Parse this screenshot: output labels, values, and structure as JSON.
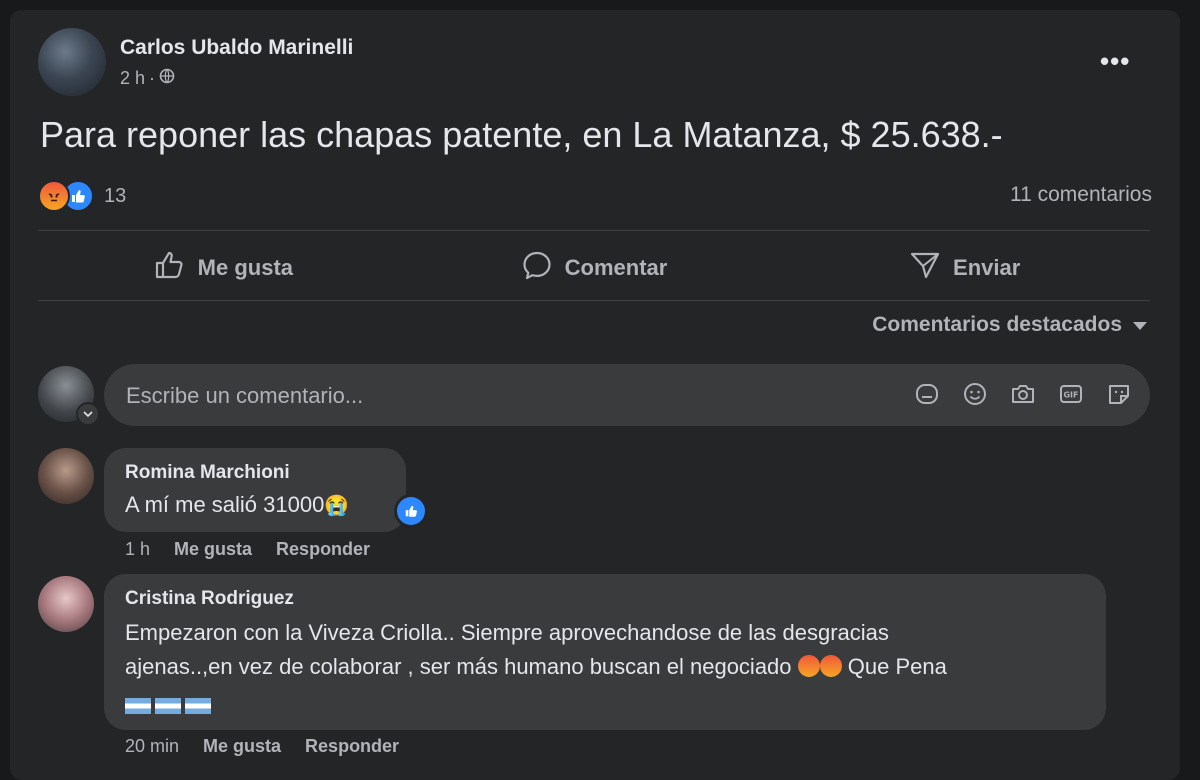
{
  "post": {
    "author": "Carlos Ubaldo Marinelli",
    "time": "2 h",
    "separator": "·",
    "audience_icon": "globe-icon",
    "text": "Para reponer las chapas patente, en La Matanza, $ 25.638.-",
    "reaction_count": "13",
    "reaction_icons": [
      "angry-reaction-icon",
      "like-reaction-icon"
    ],
    "comments_count": "11 comentarios"
  },
  "actions": {
    "like": "Me gusta",
    "comment": "Comentar",
    "share": "Enviar"
  },
  "sort": {
    "label": "Comentarios destacados"
  },
  "composer": {
    "placeholder": "Escribe un comentario...",
    "icons": [
      "avatar-sticker-icon",
      "emoji-icon",
      "camera-icon",
      "gif-icon",
      "sticker-icon"
    ]
  },
  "comments": [
    {
      "author": "Romina Marchioni",
      "text": "A mí me salió 31000",
      "emoji": "😭",
      "time": "1 h",
      "like": "Me gusta",
      "reply": "Responder"
    },
    {
      "author": "Cristina Rodriguez",
      "line1": "Empezaron con la Viveza Criolla.. Siempre aprovechandose de las desgracias",
      "line2": "ajenas..,en vez de colaborar , ser más humano buscan el negociado",
      "line2_suffix": "Que Pena",
      "time": "20 min",
      "like": "Me gusta",
      "reply": "Responder"
    }
  ],
  "colors": {
    "background": "#18191a",
    "card": "#242526",
    "bubble": "#3a3b3c",
    "primary_text": "#e4e6eb",
    "secondary_text": "#b0b3b8",
    "like_blue": "#2d88ff"
  }
}
